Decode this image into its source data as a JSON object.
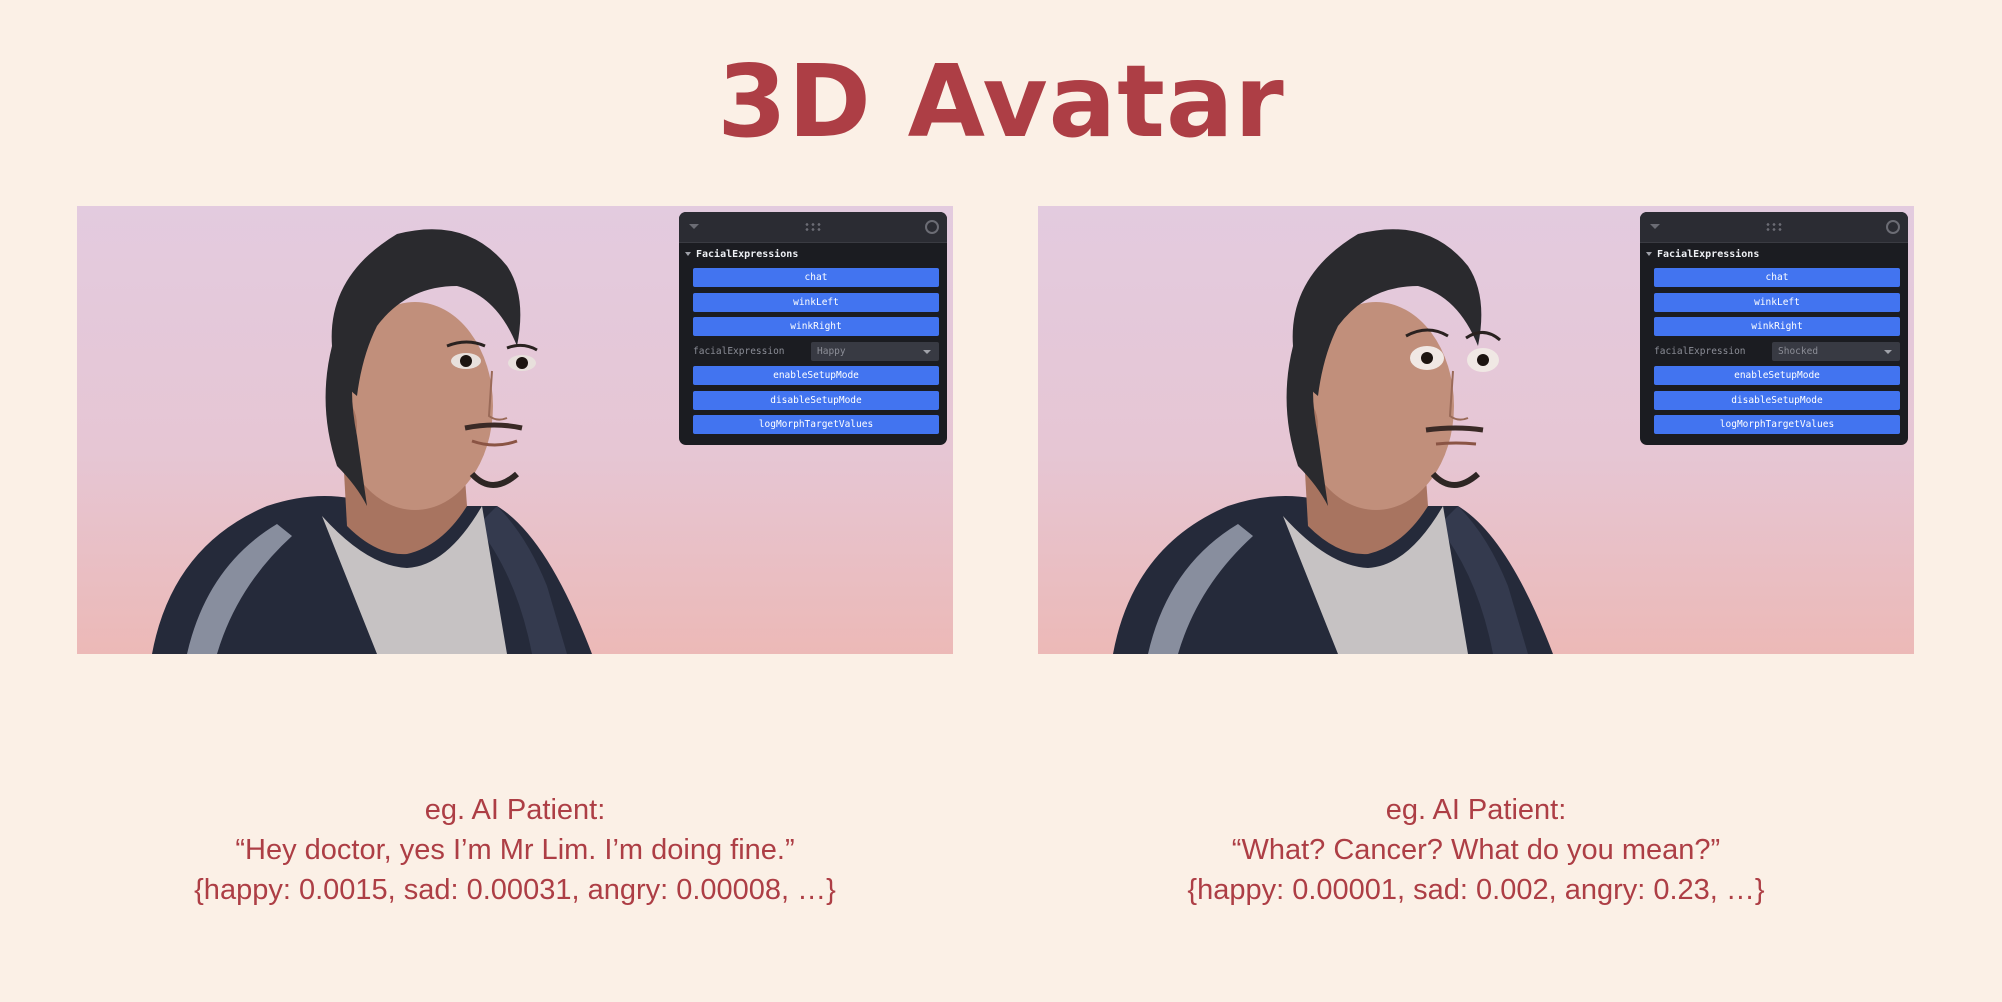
{
  "title": "3D Avatar",
  "panels": [
    {
      "gui": {
        "folder": "FacialExpressions",
        "buttons": [
          "chat",
          "winkLeft",
          "winkRight"
        ],
        "select_label": "facialExpression",
        "select_value": "Happy",
        "buttons2": [
          "enableSetupMode",
          "disableSetupMode",
          "logMorphTargetValues"
        ]
      },
      "caption": {
        "line1": "eg. AI Patient:",
        "line2": "“Hey doctor, yes I’m Mr Lim. I’m doing fine.”",
        "line3": "{happy: 0.0015, sad: 0.00031, angry: 0.00008, …}"
      }
    },
    {
      "gui": {
        "folder": "FacialExpressions",
        "buttons": [
          "chat",
          "winkLeft",
          "winkRight"
        ],
        "select_label": "facialExpression",
        "select_value": "Shocked",
        "buttons2": [
          "enableSetupMode",
          "disableSetupMode",
          "logMorphTargetValues"
        ]
      },
      "caption": {
        "line1": "eg. AI Patient:",
        "line2": "“What? Cancer? What do you mean?”",
        "line3": "{happy: 0.00001, sad: 0.002, angry: 0.23, …}"
      }
    }
  ],
  "colors": {
    "background": "#fbf0e6",
    "accent": "#ad3e45",
    "gui_button": "#4274f0",
    "gui_panel": "#1b1c21"
  }
}
